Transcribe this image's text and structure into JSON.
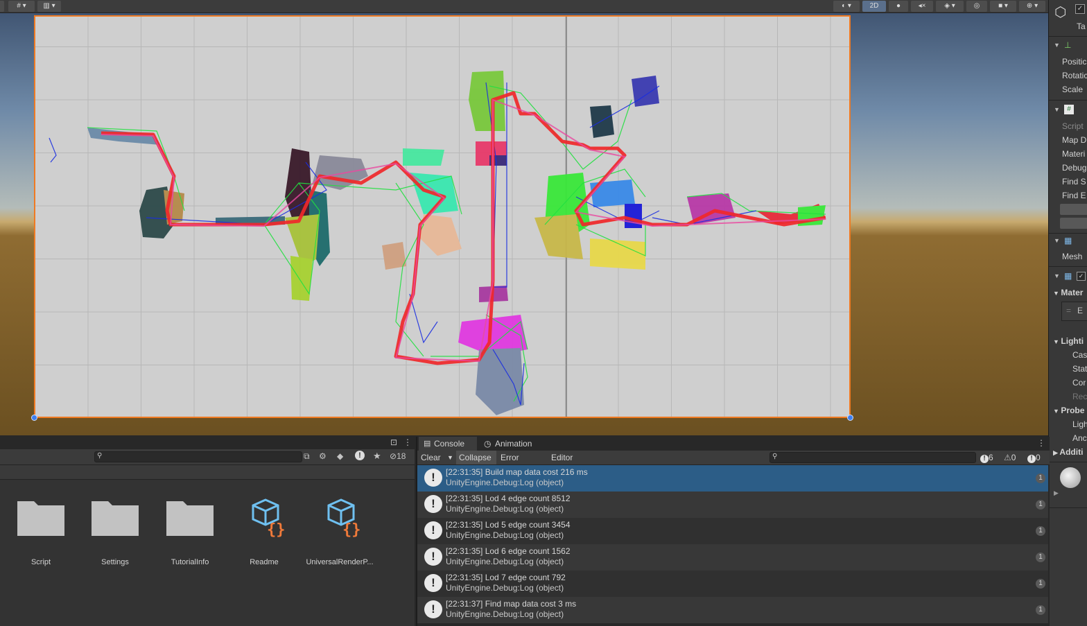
{
  "scene": {
    "toolbar": {
      "mode_2d_label": "2D"
    }
  },
  "inspector": {
    "object_name_fragment": "Ta",
    "transform_fields": [
      "Positic",
      "Rotatic",
      "Scale"
    ],
    "script_fields": [
      "Script",
      "Map D",
      "Materi",
      "Debug",
      "Find S",
      "Find E"
    ],
    "mesh_label": "Mesh",
    "materials_label": "Mater",
    "material_item_fragment": "E",
    "lighting_label": "Lighti",
    "lighting_fields": [
      "Cas",
      "Stat",
      "Cor",
      "Rec"
    ],
    "probes_label": "Probe",
    "probes_fields": [
      "Ligh",
      "Anc"
    ],
    "additional_label": "Additi"
  },
  "project": {
    "hidden_count": "18",
    "assets": [
      {
        "name": "Script",
        "type": "folder"
      },
      {
        "name": "Settings",
        "type": "folder"
      },
      {
        "name": "TutorialInfo",
        "type": "folder"
      },
      {
        "name": "Readme",
        "type": "script-asset"
      },
      {
        "name": "UniversalRenderP...",
        "type": "script-asset"
      }
    ]
  },
  "console": {
    "tabs": [
      "Console",
      "Animation"
    ],
    "toolbar": {
      "clear": "Clear",
      "collapse": "Collapse",
      "error_pause": "Error Pause",
      "editor": "Editor"
    },
    "counts": {
      "info": "6",
      "warning": "0",
      "error": "0"
    },
    "logs": [
      {
        "message": "[22:31:35] Build map data cost 216 ms",
        "source": "UnityEngine.Debug:Log (object)",
        "count": "1",
        "selected": true
      },
      {
        "message": "[22:31:35] Lod 4 edge count 8512",
        "source": "UnityEngine.Debug:Log (object)",
        "count": "1",
        "selected": false
      },
      {
        "message": "[22:31:35] Lod 5 edge count 3454",
        "source": "UnityEngine.Debug:Log (object)",
        "count": "1",
        "selected": false
      },
      {
        "message": "[22:31:35] Lod 6 edge count 1562",
        "source": "UnityEngine.Debug:Log (object)",
        "count": "1",
        "selected": false
      },
      {
        "message": "[22:31:35] Lod 7 edge count 792",
        "source": "UnityEngine.Debug:Log (object)",
        "count": "1",
        "selected": false
      },
      {
        "message": "[22:31:37] Find map data cost 3 ms",
        "source": "UnityEngine.Debug:Log (object)",
        "count": "1",
        "selected": false
      }
    ]
  },
  "colors": {
    "selection_blue": "#2c5d87",
    "selection_outline": "#f07a22",
    "path_red": "#f0282a",
    "edge_green": "#22e040",
    "edge_blue": "#1a2de0"
  }
}
